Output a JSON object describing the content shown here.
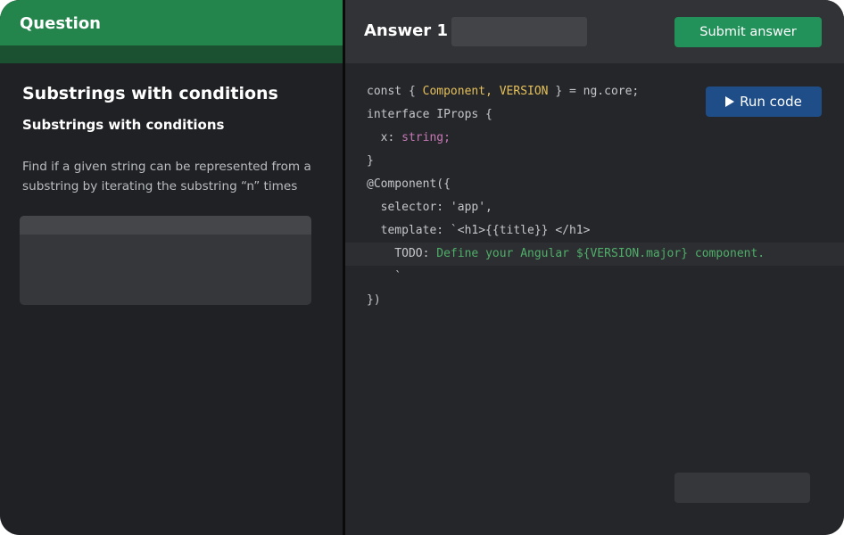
{
  "question": {
    "header": "Question",
    "title": "Substrings with conditions",
    "subtitle": "Substrings with conditions",
    "description": "Find if a given string can be represented from a substring by iterating the substring “n” times"
  },
  "answer": {
    "title": "Answer 1",
    "name_value": "",
    "submit_label": "Submit answer",
    "run_label": "Run code",
    "run_icon": "play-icon"
  },
  "code": {
    "l1a": "const { ",
    "l1b": "Component, VERSION",
    "l1c": " } = ng.core;",
    "l2": "interface IProps {",
    "l3a": "  x: ",
    "l3b": "string;",
    "l4": "}",
    "l5": "@Component({",
    "l6": "  selector: 'app',",
    "l7": "  template: `<h1>{{title}} </h1>",
    "l8a": "    TODO: ",
    "l8b": "Define your Angular ${VERSION.major} component.",
    "l9": "    `",
    "l10": "})"
  },
  "colors": {
    "question_header": "#23844c",
    "submit": "#23915a",
    "run": "#1f4d88",
    "background": "#202124"
  }
}
